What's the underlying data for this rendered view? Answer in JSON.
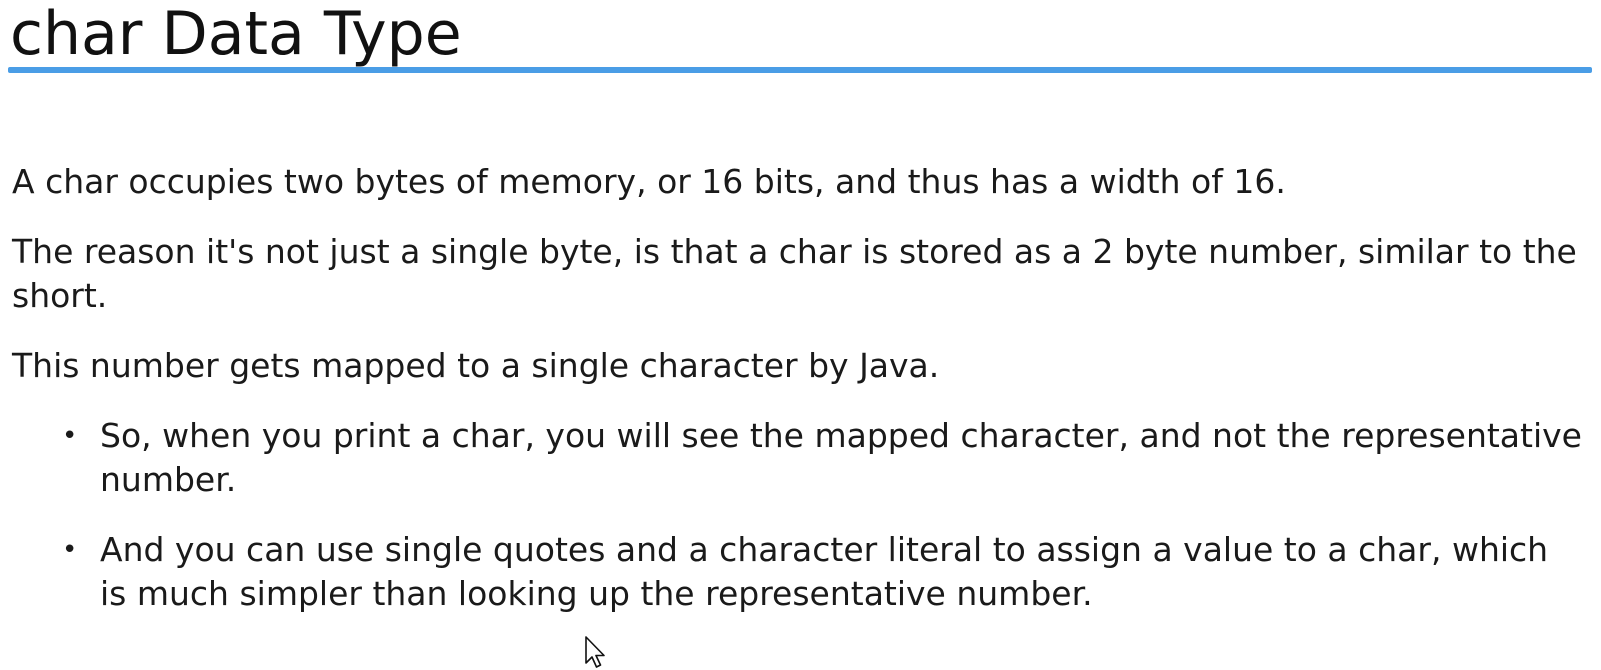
{
  "slide": {
    "title": "char Data Type",
    "accent_color": "#4a9de6",
    "paragraphs": [
      "A char occupies two bytes of memory, or 16 bits, and thus has a width of 16.",
      "The reason it's not just a single byte, is that a char is stored as a 2 byte number, similar to the short.",
      "This number gets mapped to a single character by Java."
    ],
    "bullets": [
      "So, when you print a char, you will see the mapped character, and not the representative number.",
      "And you can use single quotes and a character literal to assign a value to a char, which is much simpler than looking up the representative number."
    ],
    "bullet_symbol": "•",
    "cursor_icon": "mouse-pointer-icon"
  }
}
